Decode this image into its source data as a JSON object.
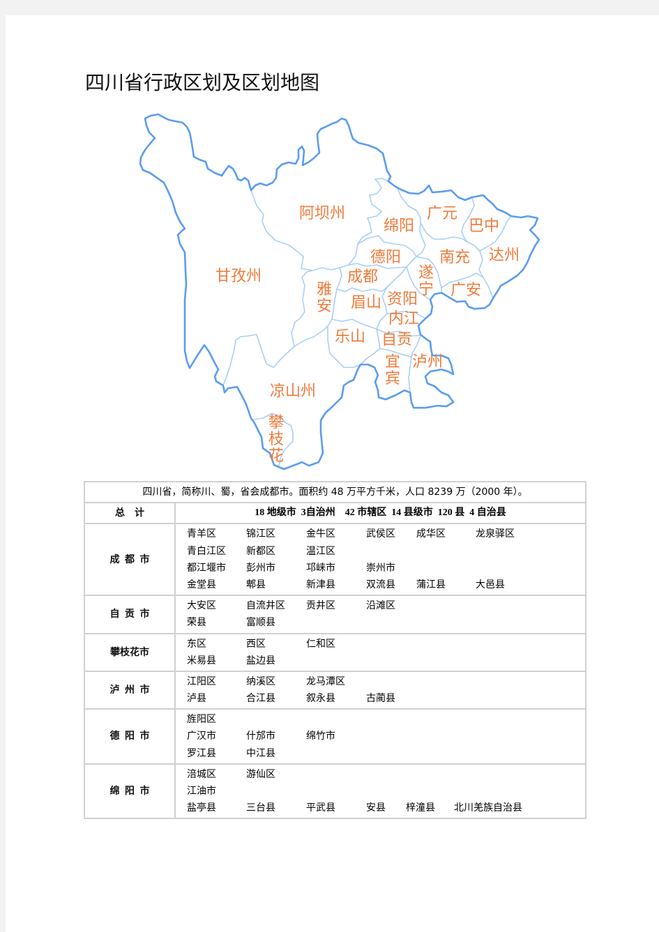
{
  "document": {
    "title": "四川省行政区划及区划地图"
  },
  "map": {
    "regions": [
      "阿坝州",
      "甘孜州",
      "绵阳",
      "广元",
      "巴中",
      "南充",
      "达州",
      "德阳",
      "成都",
      "遂宁",
      "雅安",
      "眉山",
      "资阳",
      "广安",
      "内江",
      "乐山",
      "自贡",
      "宜宾",
      "泸州",
      "凉山州",
      "攀枝花"
    ],
    "colors": {
      "outer_border": "#5a9cf0",
      "inner_border": "#a9cff7",
      "label": "#f07a3a"
    }
  },
  "table": {
    "intro": "四川省，简称川、蜀，省会成都市。面积约 48 万平方千米，人口 8239 万（2000 年）。",
    "summary": {
      "label": "总计",
      "value": "18 地级市  3自治州    42 市辖区  14 县级市  120 县  4 自治县"
    },
    "cities": [
      {
        "name": "成都市",
        "lines": [
          [
            "青羊区",
            "锦江区",
            "金牛区",
            "武侯区",
            "成华区",
            "龙泉驿区"
          ],
          [
            "青白江区",
            "新都区",
            "温江区"
          ],
          [
            "都江堰市",
            "彭州市",
            "邛崃市",
            "崇州市"
          ],
          [
            "金堂县",
            "郫县",
            "新津县",
            "双流县",
            "蒲江县",
            "大邑县"
          ]
        ]
      },
      {
        "name": "自贡市",
        "lines": [
          [
            "大安区",
            "自流井区",
            "贡井区",
            "沿滩区"
          ],
          [
            "荣县",
            "富顺县"
          ]
        ]
      },
      {
        "name": "攀枝花市",
        "lines": [
          [
            "东区",
            "西区",
            "仁和区"
          ],
          [
            "米易县",
            "盐边县"
          ]
        ]
      },
      {
        "name": "泸州市",
        "lines": [
          [
            "江阳区",
            "纳溪区",
            "龙马潭区"
          ],
          [
            "泸县",
            "合江县",
            "叙永县",
            "古蔺县"
          ]
        ]
      },
      {
        "name": "德阳市",
        "lines": [
          [
            "旌阳区"
          ],
          [
            "广汉市",
            "什邡市",
            "绵竹市"
          ],
          [
            "罗江县",
            "中江县"
          ]
        ]
      },
      {
        "name": "绵阳市",
        "lines": [
          [
            "涪城区",
            "游仙区"
          ],
          [
            "江油市"
          ],
          [
            "盐亭县",
            "三台县",
            "平武县",
            "安县",
            "梓潼县",
            "北川羌族自治县"
          ]
        ]
      }
    ]
  }
}
